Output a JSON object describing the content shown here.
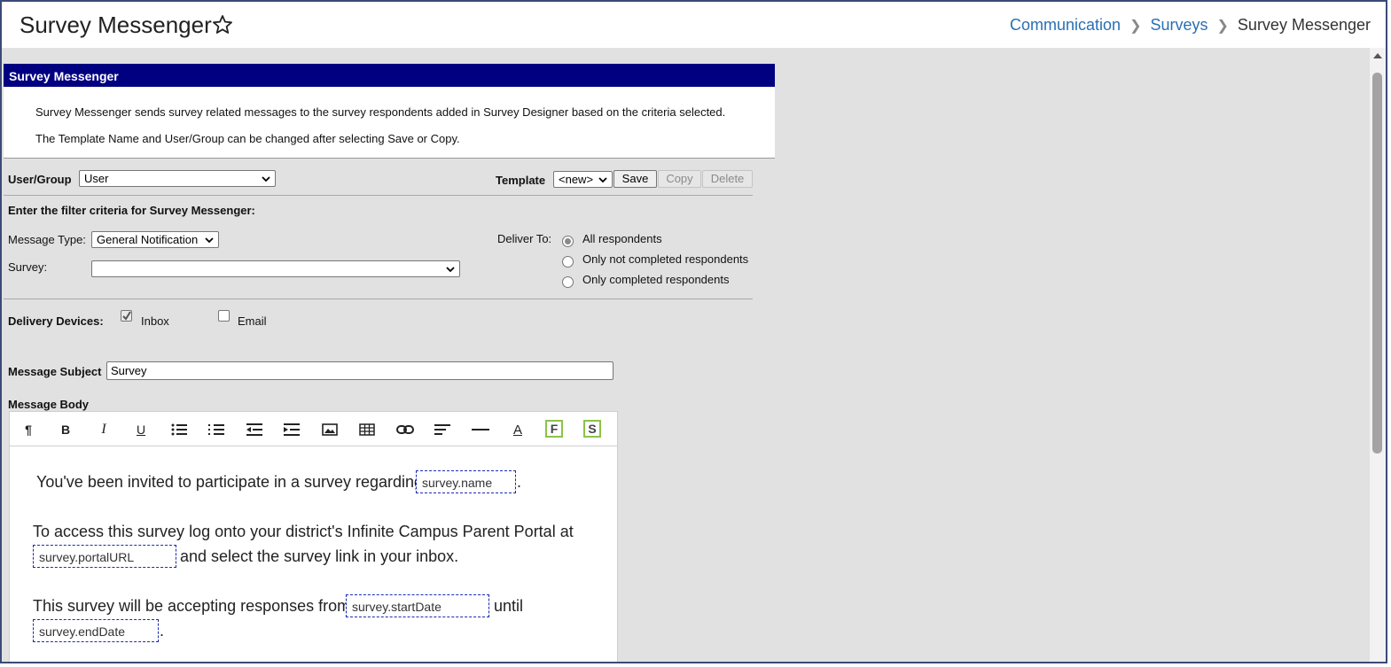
{
  "header": {
    "title": "Survey Messenger",
    "breadcrumb": [
      "Communication",
      "Surveys",
      "Survey Messenger"
    ]
  },
  "panel": {
    "title": "Survey Messenger",
    "description_1": "Survey Messenger sends survey related messages to the survey respondents added in Survey Designer based on the criteria selected.",
    "description_2": "The Template Name and User/Group can be changed after selecting Save or Copy."
  },
  "template_row": {
    "user_group_label": "User/Group",
    "user_group_value": "User",
    "template_label": "Template",
    "template_value": "<new>",
    "save_label": "Save",
    "copy_label": "Copy",
    "delete_label": "Delete"
  },
  "filter": {
    "heading": "Enter the filter criteria for Survey Messenger:",
    "message_type_label": "Message Type:",
    "message_type_value": "General Notification",
    "survey_label": "Survey:",
    "survey_value": "",
    "deliver_to_label": "Deliver To:",
    "deliver_options": [
      "All respondents",
      "Only not completed respondents",
      "Only completed respondents"
    ],
    "deliver_selected": "All respondents"
  },
  "devices": {
    "label": "Delivery Devices:",
    "inbox_label": "Inbox",
    "inbox_checked": true,
    "email_label": "Email",
    "email_checked": false
  },
  "message": {
    "subject_label": "Message Subject",
    "subject_value": "Survey",
    "body_label": "Message Body",
    "body": {
      "line1": "You've been invited to participate in a survey regarding",
      "token_name": "survey.name",
      "line2": "To access this survey log onto your district's Infinite Campus Parent Portal at",
      "token_portal": "survey.portalURL",
      "line3": "and select the survey link in your inbox.",
      "line4": "This survey will be accepting responses from",
      "token_start": "survey.startDate",
      "line5": "until",
      "token_end": "survey.endDate",
      "period": "."
    }
  },
  "toolbar": {
    "icons": [
      "paragraph-icon",
      "bold-icon",
      "italic-icon",
      "underline-icon",
      "bullet-list-icon",
      "numbered-list-icon",
      "outdent-icon",
      "indent-icon",
      "image-icon",
      "table-icon",
      "link-icon",
      "align-icon",
      "horizontal-rule-icon",
      "font-color-icon",
      "field-icon",
      "sub-report-icon"
    ],
    "field_letter": "F",
    "sub_letter": "S"
  },
  "colors": {
    "panel_header": "#000080",
    "link": "#2a6fb3",
    "toolbar_accent": "#8bc34a"
  }
}
